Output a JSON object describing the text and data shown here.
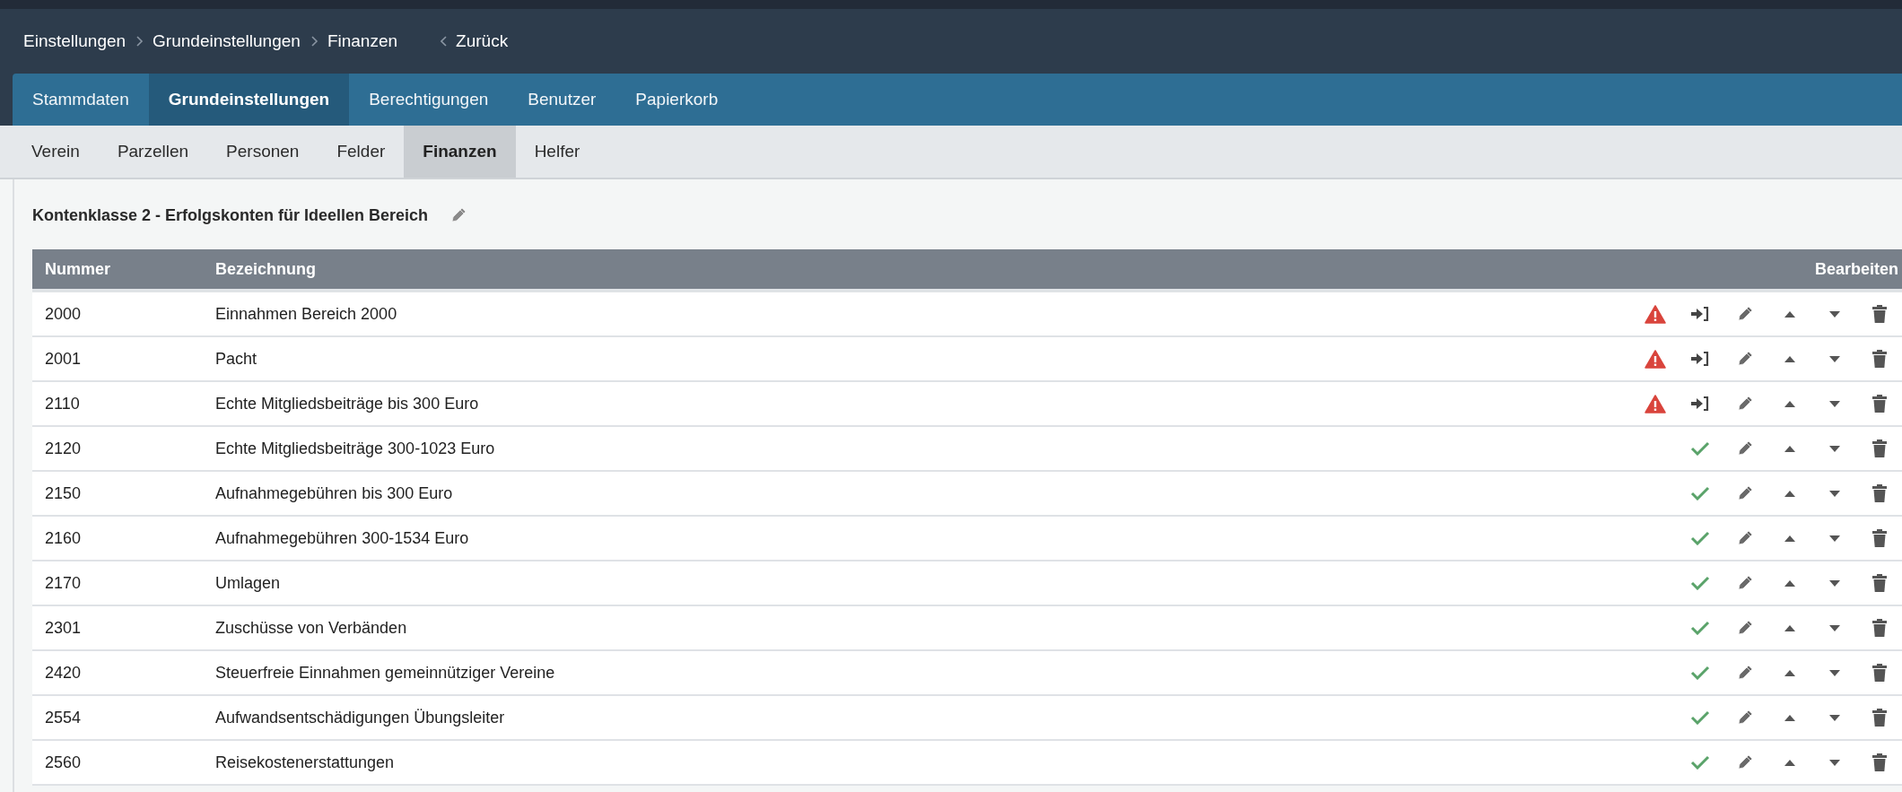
{
  "breadcrumb": {
    "items": [
      "Einstellungen",
      "Grundeinstellungen",
      "Finanzen"
    ],
    "back": "Zurück"
  },
  "tabs": [
    {
      "label": "Stammdaten",
      "selected": false
    },
    {
      "label": "Grundeinstellungen",
      "selected": true
    },
    {
      "label": "Berechtigungen",
      "selected": false
    },
    {
      "label": "Benutzer",
      "selected": false
    },
    {
      "label": "Papierkorb",
      "selected": false
    }
  ],
  "subtabs": [
    {
      "label": "Verein",
      "selected": false
    },
    {
      "label": "Parzellen",
      "selected": false
    },
    {
      "label": "Personen",
      "selected": false
    },
    {
      "label": "Felder",
      "selected": false
    },
    {
      "label": "Finanzen",
      "selected": true
    },
    {
      "label": "Helfer",
      "selected": false
    }
  ],
  "section": {
    "title": "Kontenklasse 2 - Erfolgskonten für Ideellen Bereich"
  },
  "table": {
    "columns": [
      "Nummer",
      "Bezeichnung",
      "Bearbeiten"
    ],
    "rows": [
      {
        "number": "2000",
        "name": "Einnahmen Bereich 2000",
        "warning": true
      },
      {
        "number": "2001",
        "name": "Pacht",
        "warning": true
      },
      {
        "number": "2110",
        "name": "Echte Mitgliedsbeiträge bis 300 Euro",
        "warning": true
      },
      {
        "number": "2120",
        "name": "Echte Mitgliedsbeiträge 300-1023 Euro",
        "warning": false
      },
      {
        "number": "2150",
        "name": "Aufnahmegebühren bis 300 Euro",
        "warning": false
      },
      {
        "number": "2160",
        "name": "Aufnahmegebühren 300-1534 Euro",
        "warning": false
      },
      {
        "number": "2170",
        "name": "Umlagen",
        "warning": false
      },
      {
        "number": "2301",
        "name": "Zuschüsse von Verbänden",
        "warning": false
      },
      {
        "number": "2420",
        "name": "Steuerfreie Einnahmen gemeinnütziger Vereine",
        "warning": false
      },
      {
        "number": "2554",
        "name": "Aufwandsentschädigungen Übungsleiter",
        "warning": false
      },
      {
        "number": "2560",
        "name": "Reisekostenerstattungen",
        "warning": false
      }
    ]
  }
}
